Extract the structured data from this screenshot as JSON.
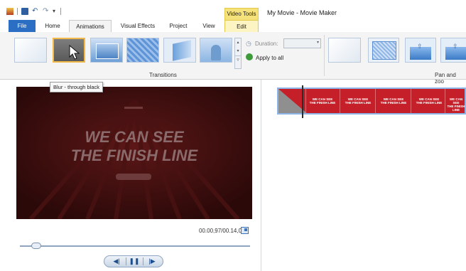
{
  "window": {
    "title": "My Movie - Movie Maker",
    "contextual_group": "Video Tools"
  },
  "tabs": {
    "file": "File",
    "home": "Home",
    "animations": "Animations",
    "visual_effects": "Visual Effects",
    "project": "Project",
    "view": "View",
    "edit": "Edit"
  },
  "ribbon": {
    "transitions_label": "Transitions",
    "duration_label": "Duration:",
    "duration_value": "",
    "apply_all_label": "Apply to all",
    "pan_zoom_label": "Pan and zoo"
  },
  "tooltip": "Blur - through black",
  "preview": {
    "line1": "WE CAN SEE",
    "line2": "THE FINISH LINE",
    "timecode": "00.00,97/00.14,00",
    "seek_fraction": 0.07
  },
  "storyboard": {
    "clip_line1": "WE CAN SEE",
    "clip_line2": "THE FINISH LINE"
  },
  "colors": {
    "accent": "#2a6fc3",
    "video_tools": "#f6e27a",
    "clip": "#c5202a"
  }
}
